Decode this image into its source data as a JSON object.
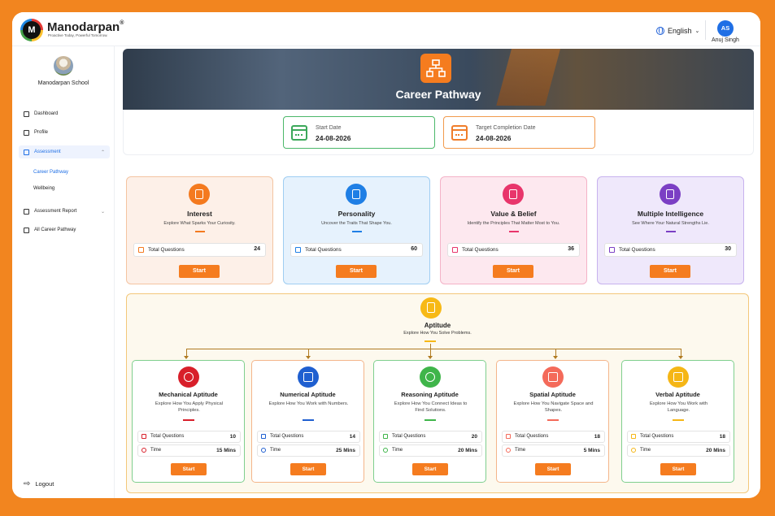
{
  "brand": {
    "name": "Manodarpan",
    "reg": "®",
    "tagline": "Proactive Today, Powerful Tomorrow.",
    "logo_text": "M"
  },
  "header": {
    "language": "English",
    "user_initials": "AS",
    "user_name": "Anuj Singh"
  },
  "sidebar": {
    "school_name": "Manodarpan School",
    "items": [
      {
        "label": "Dashboard",
        "icon": "home-icon"
      },
      {
        "label": "Profile",
        "icon": "user-icon"
      },
      {
        "label": "Assessment",
        "icon": "clipboard-icon"
      },
      {
        "label": "Assessment Report",
        "icon": "chart-icon"
      },
      {
        "label": "All Career Pathway",
        "icon": "pathway-icon"
      }
    ],
    "sub_items": [
      "Career Pathway",
      "Wellbeing"
    ],
    "logout": "Logout"
  },
  "banner": {
    "title": "Career Pathway",
    "icon": "hierarchy-icon"
  },
  "dates": {
    "start_label": "Start Date",
    "start_value": "24-08-2026",
    "end_label": "Target Completion Date",
    "end_value": "24-08-2026"
  },
  "cards": [
    {
      "title": "Interest",
      "subtitle": "Explore What Sparks Your Curiosity.",
      "q_label": "Total Questions",
      "q_value": "24",
      "button": "Start",
      "icon": "database-icon",
      "color": "#f47a1f"
    },
    {
      "title": "Personality",
      "subtitle": "Uncover the Traits That Shape You.",
      "q_label": "Total Questions",
      "q_value": "60",
      "button": "Start",
      "icon": "people-icon",
      "color": "#1f7fe5"
    },
    {
      "title": "Value & Belief",
      "subtitle": "Identify the Principles That Matter Most to You.",
      "q_label": "Total Questions",
      "q_value": "36",
      "button": "Start",
      "icon": "shield-icon",
      "color": "#e8356b"
    },
    {
      "title": "Multiple Intelligence",
      "subtitle": "See Where Your Natural Strengths Lie.",
      "q_label": "Total Questions",
      "q_value": "30",
      "button": "Start",
      "icon": "book-icon",
      "color": "#7b3fc4"
    }
  ],
  "aptitude": {
    "title": "Aptitude",
    "subtitle": "Explore How You Solve Problems.",
    "items": [
      {
        "title": "Mechanical Aptitude",
        "desc": "Explore How You Apply Physical Principles.",
        "q_label": "Total Questions",
        "q_value": "10",
        "t_label": "Time",
        "t_value": "15 Mins",
        "button": "Start",
        "icon": "gear-icon",
        "color": "#d81f2a"
      },
      {
        "title": "Numerical Aptitude",
        "desc": "Explore How You Work with Numbers.",
        "q_label": "Total Questions",
        "q_value": "14",
        "t_label": "Time",
        "t_value": "25 Mins",
        "button": "Start",
        "icon": "calculator-icon",
        "color": "#1f5fd0"
      },
      {
        "title": "Reasoning Aptitude",
        "desc": "Explore How You Connect Ideas to Find Solutions.",
        "q_label": "Total Questions",
        "q_value": "20",
        "t_label": "Time",
        "t_value": "20 Mins",
        "button": "Start",
        "icon": "brain-icon",
        "color": "#3fb54a"
      },
      {
        "title": "Spatial Aptitude",
        "desc": "Explore How You Navigate Space and Shapes.",
        "q_label": "Total Questions",
        "q_value": "18",
        "t_label": "Time",
        "t_value": "5 Mins",
        "button": "Start",
        "icon": "cube-icon",
        "color": "#f46a5a"
      },
      {
        "title": "Verbal Aptitude",
        "desc": "Explore How You Work with Language.",
        "q_label": "Total Questions",
        "q_value": "18",
        "t_label": "Time",
        "t_value": "20 Mins",
        "button": "Start",
        "icon": "speech-icon",
        "color": "#f5b616"
      }
    ]
  }
}
